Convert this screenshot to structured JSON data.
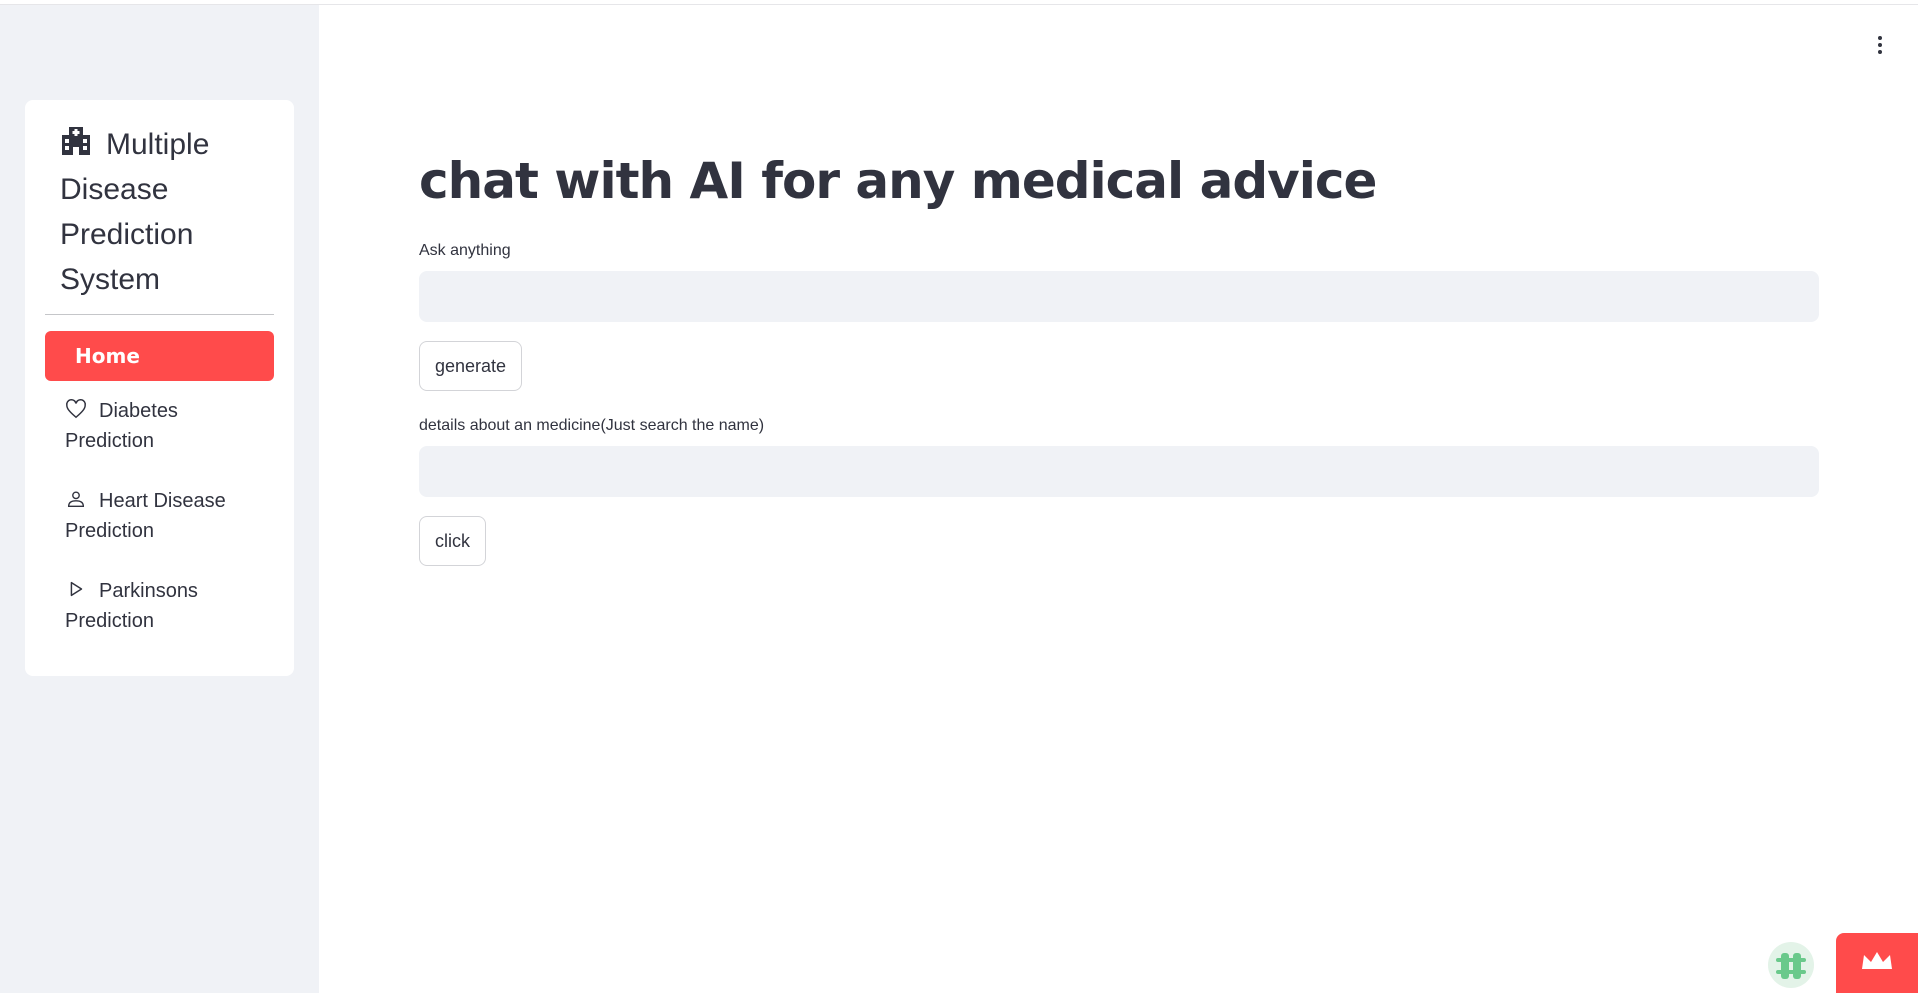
{
  "sidebar": {
    "menu_title": "Multiple Disease Prediction System",
    "menu_icon": "hospital-icon",
    "items": [
      {
        "label": "Home",
        "icon": "house-icon",
        "selected": true
      },
      {
        "label": "Diabetes Prediction",
        "icon": "heart-icon"
      },
      {
        "label": "Heart Disease Prediction",
        "icon": "person-icon"
      },
      {
        "label": "Parkinsons Prediction",
        "icon": "play-icon"
      }
    ],
    "accent_color": "#ff4b4b"
  },
  "main": {
    "title": "chat with AI for any medical advice",
    "ask": {
      "label": "Ask anything",
      "value": "",
      "button": "generate"
    },
    "medicine": {
      "label": "details about an medicine(Just search the name)",
      "value": "",
      "button": "click"
    }
  },
  "toolbar": {
    "menu_icon": "kebab-menu-icon"
  },
  "badges": {
    "left": "bug-icon",
    "right": "crown-icon"
  }
}
